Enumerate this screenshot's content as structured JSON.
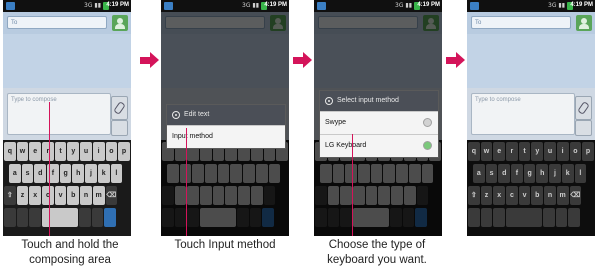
{
  "status_bar": {
    "time": "4:19 PM",
    "icons": "3G ▮▮"
  },
  "message": {
    "to_placeholder": "To",
    "compose_placeholder": "Type to compose"
  },
  "keyboard_rows": [
    [
      "q",
      "w",
      "e",
      "r",
      "t",
      "y",
      "u",
      "i",
      "o",
      "p"
    ],
    [
      "a",
      "s",
      "d",
      "f",
      "g",
      "h",
      "j",
      "k",
      "l"
    ],
    [
      "z",
      "x",
      "c",
      "v",
      "b",
      "n",
      "m"
    ]
  ],
  "dialog_edit": {
    "title": "Edit text",
    "item": "Input method"
  },
  "dialog_select": {
    "title": "Select input method",
    "options": [
      "Swype",
      "LG Keyboard"
    ]
  },
  "captions": [
    "Touch and hold the\ncomposing area",
    "Touch Input method",
    "Choose the type of\nkeyboard you want."
  ],
  "colors": {
    "accent": "#d4145a"
  }
}
